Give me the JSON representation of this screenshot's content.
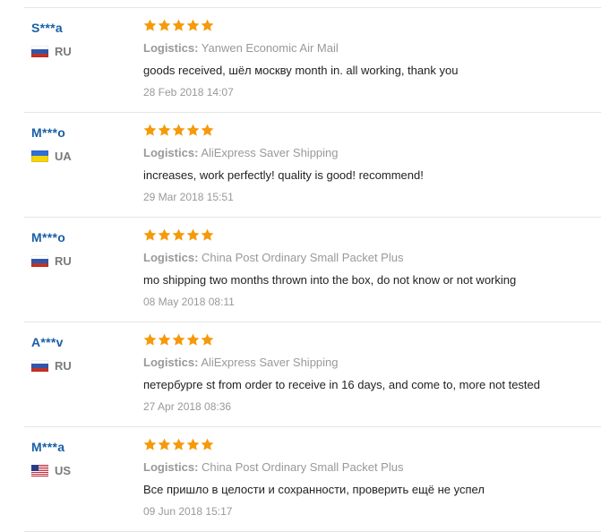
{
  "logistics_label": "Logistics:",
  "rating_max": 5,
  "star_color": "#f59a0a",
  "reviews": [
    {
      "user": "S***a",
      "country": "RU",
      "stars": 5,
      "logistics": "Yanwen Economic Air Mail",
      "comment": "goods received, шёл москву month in. all working, thank you",
      "date": "28 Feb 2018 14:07"
    },
    {
      "user": "M***o",
      "country": "UA",
      "stars": 5,
      "logistics": "AliExpress Saver Shipping",
      "comment": "increases, work perfectly! quality is good! recommend!",
      "date": "29 Mar 2018 15:51"
    },
    {
      "user": "M***o",
      "country": "RU",
      "stars": 5,
      "logistics": "China Post Ordinary Small Packet Plus",
      "comment": "mo shipping two months thrown into the box, do not know or not working",
      "date": "08 May 2018 08:11"
    },
    {
      "user": "A***v",
      "country": "RU",
      "stars": 5,
      "logistics": "AliExpress Saver Shipping",
      "comment": "петербурге st from order to receive in 16 days, and come to, more not tested",
      "date": "27 Apr 2018 08:36"
    },
    {
      "user": "M***a",
      "country": "US",
      "stars": 5,
      "logistics": "China Post Ordinary Small Packet Plus",
      "comment": "Все пришло в целости и сохранности, проверить ещё не успел",
      "date": "09 Jun 2018 15:17"
    }
  ]
}
